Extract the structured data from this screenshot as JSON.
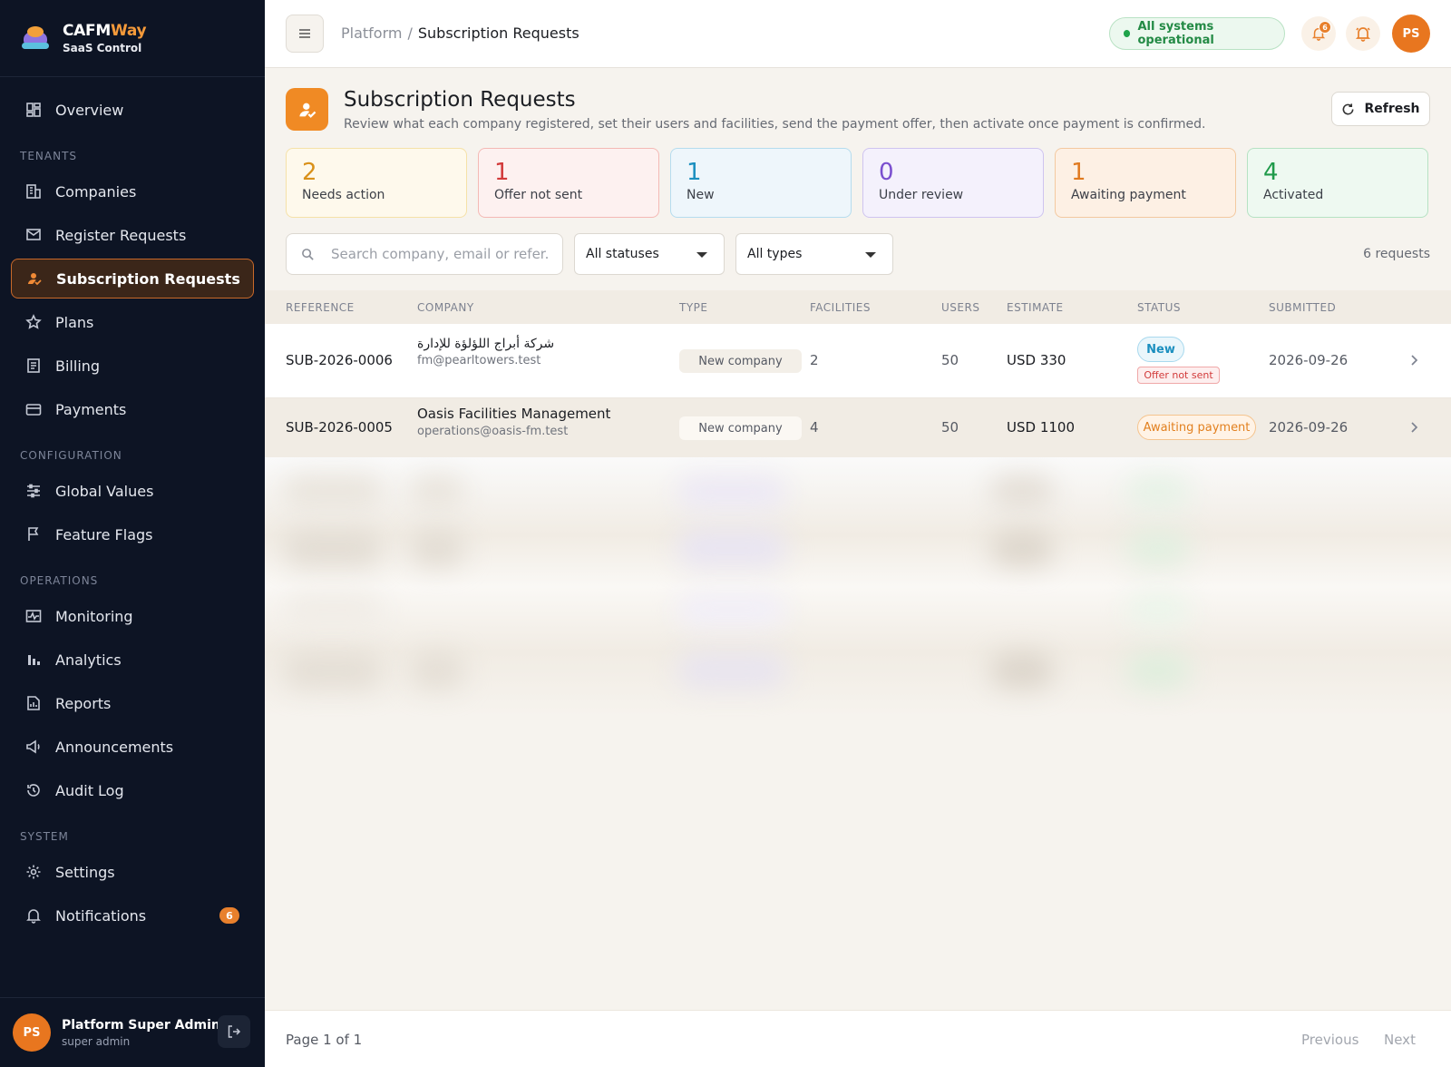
{
  "brand": {
    "name_a": "CAFM",
    "name_b": "Way",
    "subtitle": "SaaS Control"
  },
  "sidebar": {
    "overview": "Overview",
    "sections": {
      "tenants": "TENANTS",
      "configuration": "CONFIGURATION",
      "operations": "OPERATIONS",
      "system": "SYSTEM"
    },
    "items": {
      "companies": "Companies",
      "register_requests": "Register Requests",
      "subscription_requests": "Subscription Requests",
      "plans": "Plans",
      "billing": "Billing",
      "payments": "Payments",
      "global_values": "Global Values",
      "feature_flags": "Feature Flags",
      "monitoring": "Monitoring",
      "analytics": "Analytics",
      "reports": "Reports",
      "announcements": "Announcements",
      "audit_log": "Audit Log",
      "settings": "Settings",
      "notifications": "Notifications",
      "notifications_badge": "6"
    },
    "user": {
      "initials": "PS",
      "name": "Platform Super Admin",
      "role": "super admin"
    }
  },
  "topbar": {
    "breadcrumb_root": "Platform",
    "breadcrumb_sep": "/",
    "breadcrumb_current": "Subscription Requests",
    "status": "All systems operational",
    "notif_badge": "6",
    "avatar": "PS"
  },
  "page": {
    "title": "Subscription Requests",
    "description": "Review what each company registered, set their users and facilities, send the payment offer, then activate once payment is confirmed.",
    "refresh_label": "Refresh"
  },
  "stats": [
    {
      "value": "2",
      "label": "Needs action",
      "color": "#d9911a",
      "bg": "#fef9ec",
      "border": "#f5e1a8"
    },
    {
      "value": "1",
      "label": "Offer not sent",
      "color": "#d23a3a",
      "bg": "#fdf1f0",
      "border": "#f4b9b5"
    },
    {
      "value": "1",
      "label": "New",
      "color": "#1b8fbf",
      "bg": "#eef6fb",
      "border": "#b5dcee"
    },
    {
      "value": "0",
      "label": "Under review",
      "color": "#7a4fcf",
      "bg": "#f4f1fc",
      "border": "#cfc4f0"
    },
    {
      "value": "1",
      "label": "Awaiting payment",
      "color": "#e07a20",
      "bg": "#fdf0e4",
      "border": "#f3c9a0"
    },
    {
      "value": "4",
      "label": "Activated",
      "color": "#1f9a4a",
      "bg": "#eef9f1",
      "border": "#b6e2c3"
    }
  ],
  "filters": {
    "search_placeholder": "Search company, email or refer...",
    "status": "All statuses",
    "type": "All types",
    "count": "6 requests"
  },
  "table": {
    "columns": {
      "reference": "REFERENCE",
      "company": "COMPANY",
      "type": "TYPE",
      "facilities": "FACILITIES",
      "users": "USERS",
      "estimate": "ESTIMATE",
      "status": "STATUS",
      "submitted": "SUBMITTED"
    },
    "rows": [
      {
        "reference": "SUB-2026-0006",
        "company": "شركة أبراج اللؤلؤة للإدارة",
        "email": "fm@pearltowers.test",
        "type": "New company",
        "facilities": "2",
        "users": "50",
        "estimate": "USD 330",
        "status": "New",
        "status_sub": "Offer not sent",
        "submitted": "2026-09-26"
      },
      {
        "reference": "SUB-2026-0005",
        "company": "Oasis Facilities Management",
        "email": "operations@oasis-fm.test",
        "type": "New company",
        "facilities": "4",
        "users": "50",
        "estimate": "USD 1100",
        "status": "Awaiting payment",
        "submitted": "2026-09-26"
      }
    ]
  },
  "footer": {
    "page_info": "Page 1 of 1",
    "previous": "Previous",
    "next": "Next"
  }
}
